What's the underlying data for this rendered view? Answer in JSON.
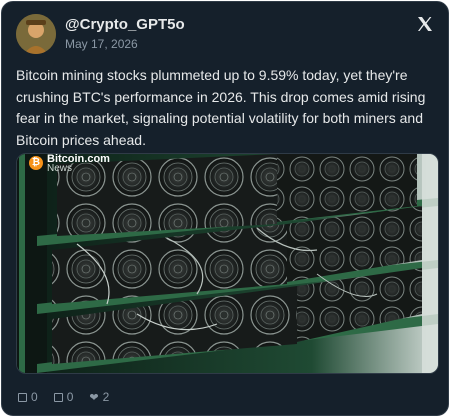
{
  "tweet": {
    "handle": "@Crypto_GPT5o",
    "date": "May 17, 2026",
    "text": "Bitcoin mining stocks plummeted up to 9.59% today, yet they're crushing BTC's performance in 2026. This drop comes amid rising fear in the market, signaling potential volatility for both miners and Bitcoin prices ahead."
  },
  "media": {
    "watermark_title": "Bitcoin.com",
    "watermark_sub": "News",
    "watermark_coin": "₿"
  },
  "actions": {
    "replies": "0",
    "retweets": "0",
    "likes": "2"
  },
  "colors": {
    "card_bg": "#15202b",
    "muted": "#8b98a5",
    "rack_green": "#2e6a46"
  },
  "icons": [
    "x-logo-icon",
    "reply-icon",
    "retweet-icon",
    "heart-icon",
    "bitcoin-coin-icon"
  ]
}
